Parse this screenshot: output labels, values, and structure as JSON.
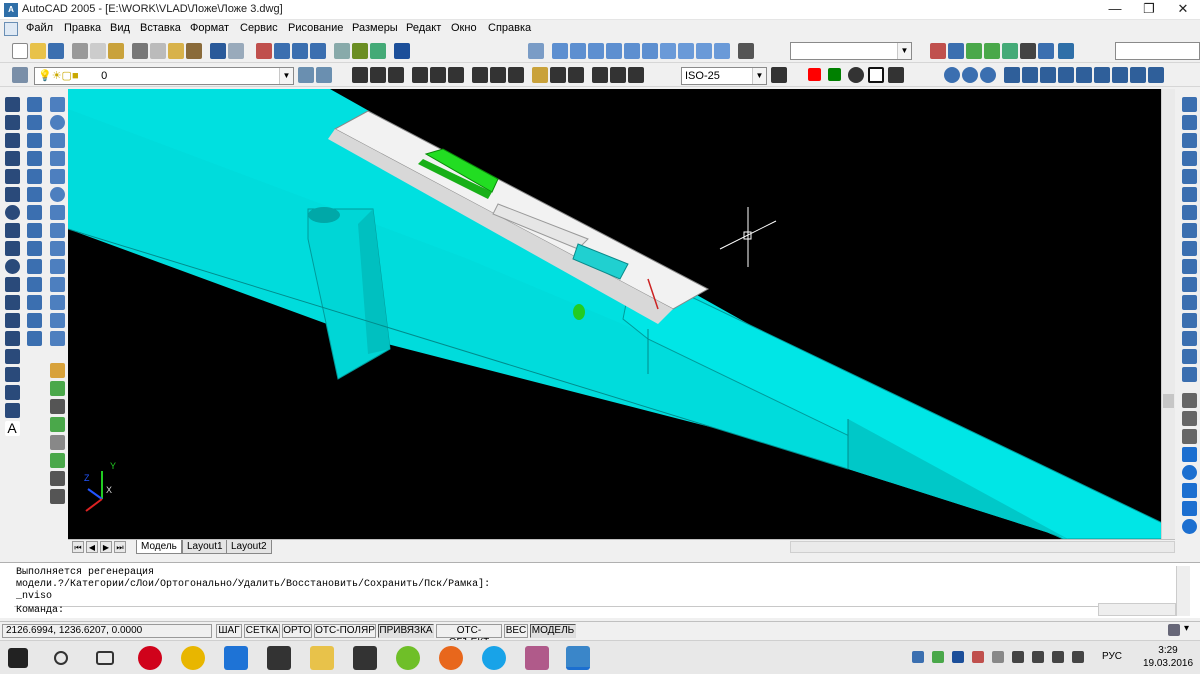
{
  "window": {
    "title": "AutoCAD 2005 - [E:\\WORK\\VLAD\\Ложе\\Ложе 3.dwg]",
    "app_icon": "autocad-app-icon",
    "controls": [
      "minimize-icon",
      "maximize-icon",
      "close-icon"
    ],
    "minimize": "—",
    "maximize": "❐",
    "close": "✕"
  },
  "menu": {
    "items": [
      "Файл",
      "Правка",
      "Вид",
      "Вставка",
      "Формат",
      "Сервис",
      "Рисование",
      "Размеры",
      "Редакт",
      "Окно",
      "Справка"
    ]
  },
  "toolbar_std": {
    "icons": [
      "new-icon",
      "open-icon",
      "save-icon",
      "print-icon",
      "preview-icon",
      "publish-icon",
      "cut-icon",
      "copy-icon",
      "paste-icon",
      "match-properties-icon",
      "undo-icon",
      "redo-icon",
      "pan-icon",
      "zoom-realtime-icon",
      "zoom-window-icon",
      "zoom-previous-icon",
      "properties-icon",
      "design-center-icon",
      "tool-palettes-icon",
      "help-icon"
    ],
    "views_icons": [
      "named-views-icon",
      "top-view-icon",
      "bottom-view-icon",
      "left-view-icon",
      "right-view-icon",
      "front-view-icon",
      "back-view-icon",
      "sw-iso-icon",
      "se-iso-icon",
      "ne-iso-icon",
      "nw-iso-icon",
      "camera-icon"
    ],
    "view_combo": "",
    "right_icons": [
      "ucs-icon",
      "world-ucs-icon",
      "object-ucs-icon",
      "face-ucs-icon",
      "view-ucs-icon",
      "origin-ucs-icon",
      "zaxis-ucs-icon"
    ],
    "right_combo": ""
  },
  "toolbar_layers": {
    "layer_name": "0",
    "dim_style": "ISO-25",
    "colors": {
      "red": "#ff0000",
      "green": "#008000"
    }
  },
  "layout_tabs": [
    "Модель",
    "Layout1",
    "Layout2"
  ],
  "command": {
    "history": [
      "Выполняется регенерация",
      "модели.?/Категории/сЛои/Ортогонально/Удалить/Восстановить/Сохранить/Пск/Рамка]:",
      "_nviso"
    ],
    "prompt": "Команда:"
  },
  "status": {
    "coordinates": "2126.6994, 1236.6207, 0.0000",
    "buttons": [
      "ШАГ",
      "СЕТКА",
      "ОРТО",
      "ОТС-ПОЛЯР",
      "ПРИВЯЗКА",
      "ОТС-ОБЪЕКТ",
      "ВЕС",
      "МОДЕЛЬ"
    ],
    "pressed": [
      "ПРИВЯЗКА",
      "МОДЕЛЬ"
    ]
  },
  "ucs": {
    "x": "X",
    "y": "Y",
    "z": "Z"
  },
  "taskbar": {
    "apps": [
      "windows-start-icon",
      "search-icon",
      "task-view-icon",
      "opera-icon",
      "chrome-icon",
      "edge-icon",
      "calculator-icon",
      "file-explorer-icon",
      "store-icon",
      "utorrent-icon",
      "firefox-icon",
      "skype-icon",
      "paint-icon",
      "autocad-taskbar-icon"
    ],
    "language": "РУС",
    "time": "3:29",
    "date": "19.03.2016"
  }
}
